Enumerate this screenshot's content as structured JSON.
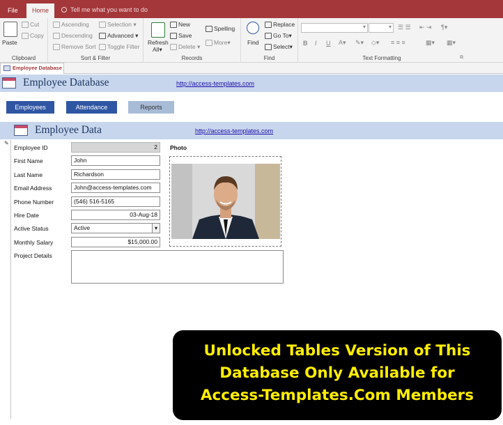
{
  "ribbon_tabs": {
    "file": "File",
    "home": "Home",
    "tell_me": "Tell me what you want to do"
  },
  "clipboard": {
    "paste": "Paste",
    "cut": "Cut",
    "copy": "Copy",
    "group": "Clipboard"
  },
  "sort_filter": {
    "ascending": "Ascending",
    "descending": "Descending",
    "remove_sort": "Remove Sort",
    "selection": "Selection",
    "advanced": "Advanced",
    "toggle_filter": "Toggle Filter",
    "group": "Sort & Filter"
  },
  "records": {
    "refresh": "Refresh",
    "refresh_all": "All",
    "new": "New",
    "save": "Save",
    "delete": "Delete",
    "spelling": "Spelling",
    "more": "More",
    "group": "Records"
  },
  "find": {
    "find": "Find",
    "replace": "Replace",
    "goto": "Go To",
    "select": "Select",
    "group": "Find"
  },
  "text_formatting": {
    "bold": "B",
    "italic": "I",
    "underline": "U",
    "group": "Text Formatting"
  },
  "document_tab": "Employee Database",
  "header": {
    "title": "Employee Database",
    "link": "http://access-templates.com"
  },
  "nav": {
    "employees": "Employees",
    "attendance": "Attendance",
    "reports": "Reports"
  },
  "subform": {
    "title": "Employee Data",
    "link": "http://access-templates.com"
  },
  "fields": {
    "employee_id": {
      "label": "Employee ID",
      "value": "2"
    },
    "first_name": {
      "label": "First Name",
      "value": "John"
    },
    "last_name": {
      "label": "Last Name",
      "value": "Richardson"
    },
    "email": {
      "label": "Email Address",
      "value": "John@access-templates.com"
    },
    "phone": {
      "label": "Phone Number",
      "value": "(546) 516-5165"
    },
    "hire_date": {
      "label": "Hire Date",
      "value": "03-Aug-18"
    },
    "status": {
      "label": "Active Status",
      "value": "Active"
    },
    "salary": {
      "label": "Monthly Salary",
      "value": "$15,000.00"
    },
    "project": {
      "label": "Project Details",
      "value": ""
    }
  },
  "photo_label": "Photo",
  "banner": {
    "line1": "Unlocked Tables Version of This",
    "line2": "Database Only Available for",
    "line3": "Access-Templates.Com Members"
  },
  "colors": {
    "title_bar": "#a4373a",
    "header_band": "#c7d6ec",
    "nav_button": "#2f56a3",
    "banner_text": "#ffee00"
  }
}
